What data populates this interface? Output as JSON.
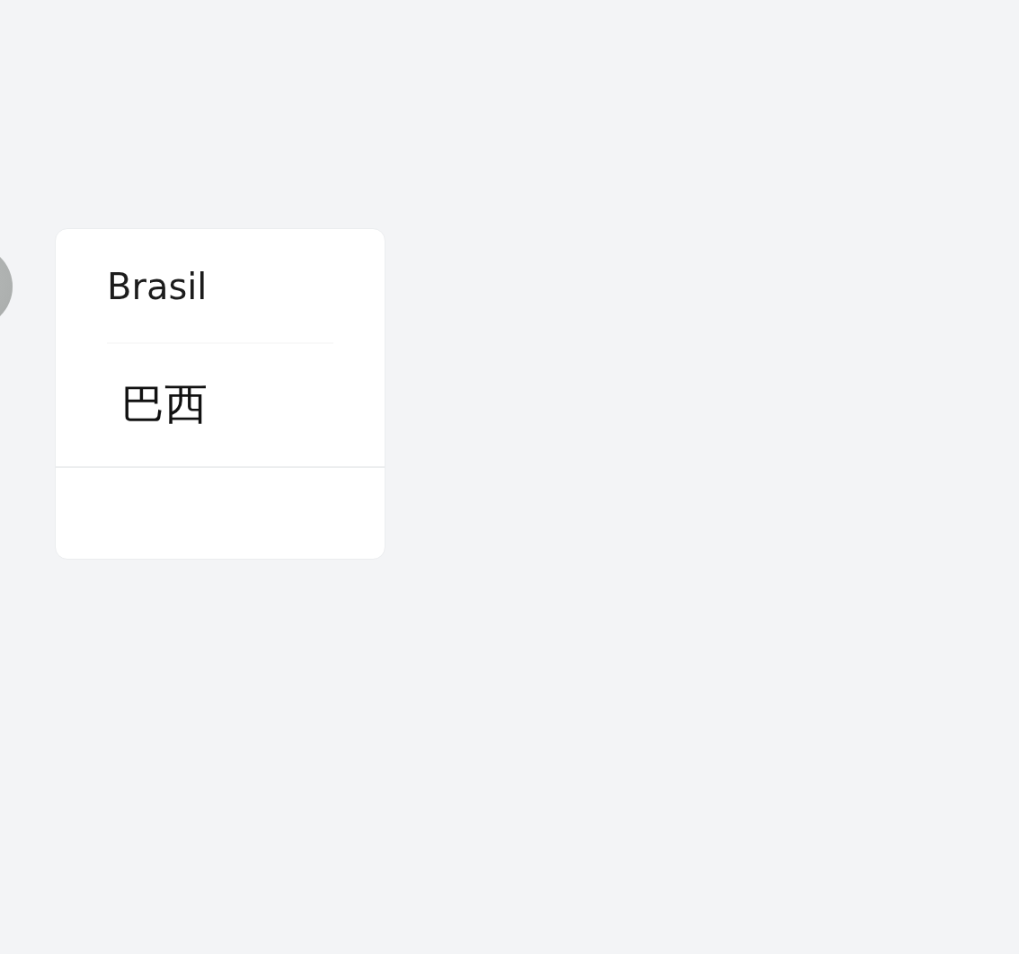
{
  "message": {
    "text": "Brasil",
    "translation": "巴西"
  }
}
